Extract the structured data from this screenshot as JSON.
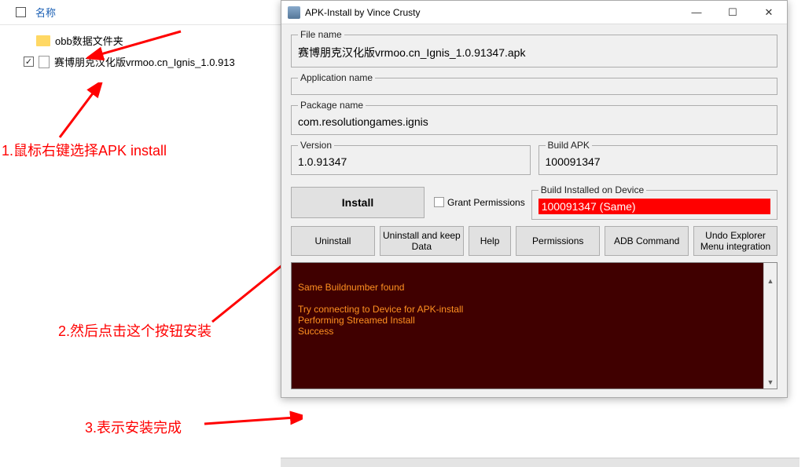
{
  "explorer": {
    "header_name": "名称",
    "items": [
      {
        "label": "obb数据文件夹",
        "type": "folder",
        "checked": false
      },
      {
        "label": "赛博朋克汉化版vrmoo.cn_Ignis_1.0.913",
        "type": "file",
        "checked": true
      }
    ]
  },
  "annotations": {
    "step1": "1.鼠标右键选择APK install",
    "step2": "2.然后点击这个按钮安装",
    "step3": "3.表示安装完成"
  },
  "window": {
    "title": "APK-Install by Vince Crusty",
    "file_name_label": "File name",
    "file_name_value": "赛博朋克汉化版vrmoo.cn_Ignis_1.0.91347.apk",
    "app_name_label": "Application name",
    "app_name_value": "",
    "package_name_label": "Package name",
    "package_name_value": "com.resolutiongames.ignis",
    "version_label": "Version",
    "version_value": "1.0.91347",
    "build_apk_label": "Build APK",
    "build_apk_value": "100091347",
    "install_btn": "Install",
    "grant_permissions_label": "Grant Permissions",
    "build_installed_label": "Build Installed on Device",
    "build_installed_value": "100091347 (Same)",
    "buttons": {
      "uninstall": "Uninstall",
      "uninstall_keep": "Uninstall and keep Data",
      "help": "Help",
      "permissions": "Permissions",
      "adb": "ADB Command",
      "undo": "Undo Explorer Menu integration"
    },
    "console_lines": "Same Buildnumber found\n\nTry connecting to Device for APK-install\nPerforming Streamed Install\nSuccess"
  }
}
